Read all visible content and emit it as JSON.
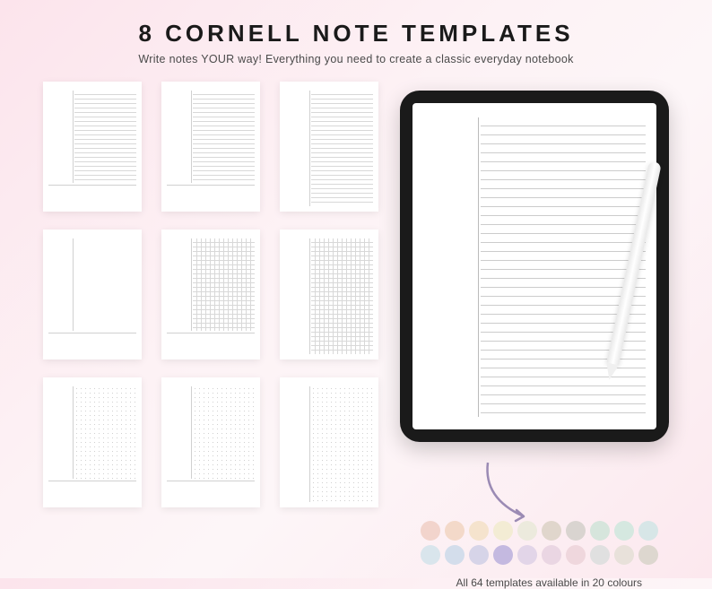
{
  "header": {
    "title": "8 CORNELL NOTE TEMPLATES",
    "subtitle": "Write notes YOUR way! Everything you need to create a classic everyday notebook"
  },
  "templates": {
    "count": 8,
    "grid_shown": 9,
    "variants": [
      {
        "cue": "blank",
        "notes": "lines",
        "summary": true
      },
      {
        "cue": "blank",
        "notes": "lines",
        "summary": true
      },
      {
        "cue": "blank",
        "notes": "lines",
        "summary": false
      },
      {
        "cue": "blank",
        "notes": "blank",
        "summary": true
      },
      {
        "cue": "blank",
        "notes": "grid",
        "summary": true
      },
      {
        "cue": "blank",
        "notes": "grid",
        "summary": false
      },
      {
        "cue": "blank",
        "notes": "dots",
        "summary": true
      },
      {
        "cue": "blank",
        "notes": "dots",
        "summary": true
      },
      {
        "cue": "blank",
        "notes": "dots",
        "summary": false
      }
    ]
  },
  "tablet": {
    "device": "iPad",
    "stylus": "Pencil",
    "template_shown": {
      "cue": "blank",
      "notes": "lines",
      "summary": false
    }
  },
  "colors": {
    "caption": "All 64 templates available in 20 colours",
    "total_templates": 64,
    "count": 20,
    "swatches": [
      "#f2d4cc",
      "#f3d9c9",
      "#f5e3cd",
      "#f3ecd4",
      "#eceadd",
      "#e0d6cc",
      "#d9d4d0",
      "#d6e5dc",
      "#d5e8e0",
      "#d7e6e7",
      "#d9e5ec",
      "#d3ddeb",
      "#d6d4e8",
      "#c4b9e0",
      "#e2d5e8",
      "#ead6e3",
      "#efd7dd",
      "#e0e0e0",
      "#e8e1da",
      "#ddd7cf"
    ]
  }
}
